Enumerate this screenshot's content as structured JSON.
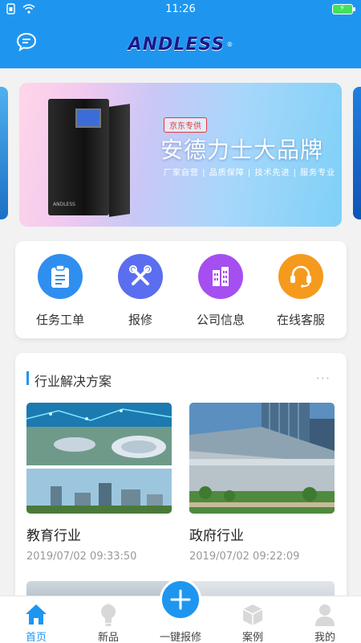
{
  "status_bar": {
    "time": "11:26"
  },
  "header": {
    "logo_text": "ANDLESS",
    "logo_mark": "®"
  },
  "banner": {
    "badge": "京东专供",
    "title": "安德力士大品牌",
    "subtitle": "厂家自营 | 品质保障 | 技术先进 | 服务专业",
    "product_label": "ANDLESS"
  },
  "quick_actions": [
    {
      "label": "任务工单",
      "icon": "clipboard-icon",
      "color": "#2f8ff0"
    },
    {
      "label": "报修",
      "icon": "tools-icon",
      "color": "#5b6ef0"
    },
    {
      "label": "公司信息",
      "icon": "building-icon",
      "color": "#a64ff0"
    },
    {
      "label": "在线客服",
      "icon": "headset-icon",
      "color": "#f59a1c"
    }
  ],
  "industry": {
    "title": "行业解决方案",
    "more": "···",
    "items": [
      {
        "name": "教育行业",
        "date": "2019/07/02 09:33:50"
      },
      {
        "name": "政府行业",
        "date": "2019/07/02 09:22:09"
      }
    ]
  },
  "nav": {
    "items": [
      {
        "label": "首页",
        "icon": "home-icon"
      },
      {
        "label": "新品",
        "icon": "lightbulb-icon"
      },
      {
        "label": "一键报修",
        "icon": "plus-icon"
      },
      {
        "label": "案例",
        "icon": "cube-icon"
      },
      {
        "label": "我的",
        "icon": "user-icon"
      }
    ],
    "active_index": 0,
    "active_color": "#1e96f0"
  }
}
